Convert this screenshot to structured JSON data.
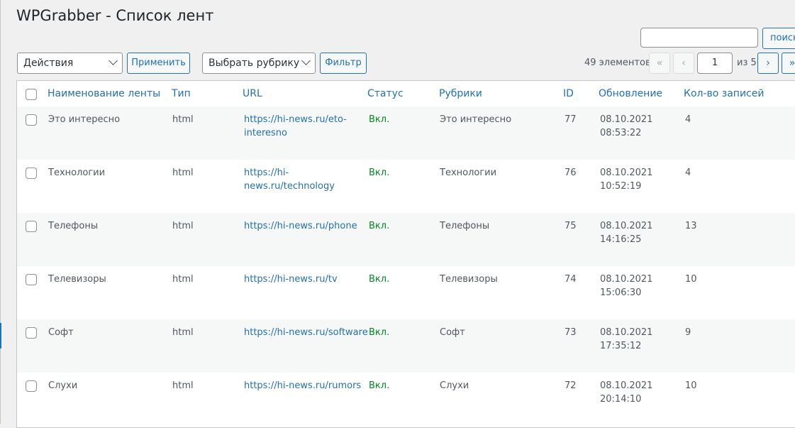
{
  "page": {
    "title": "WPGrabber - Список лент"
  },
  "search": {
    "value": "",
    "button_label": "поиск"
  },
  "toolbar": {
    "bulk_actions": "Действия",
    "apply_label": "Применить",
    "category_filter": "Выбрать рубрику",
    "filter_label": "Фильтр"
  },
  "pagination": {
    "count": "49 элементов",
    "first": "«",
    "prev": "‹",
    "current": "1",
    "of": "из 5",
    "next": "›",
    "last": "»"
  },
  "columns": [
    "Наименование ленты",
    "Тип",
    "URL",
    "Статус",
    "Рубрики",
    "ID",
    "Обновление",
    "Кол-во записей"
  ],
  "rows": [
    {
      "name": "Это интересно",
      "type": "html",
      "url1": "https://hi-news.ru/eto-",
      "url2": "interesno",
      "status": "Вкл.",
      "category": "Это интересно",
      "id": "77",
      "date": "08.10.2021",
      "time": "08:53:22",
      "count": "4"
    },
    {
      "name": "Технологии",
      "type": "html",
      "url1": "https://hi-",
      "url2": "news.ru/technology",
      "status": "Вкл.",
      "category": "Технологии",
      "id": "76",
      "date": "08.10.2021",
      "time": "10:52:19",
      "count": "4"
    },
    {
      "name": "Телефоны",
      "type": "html",
      "url1": "https://hi-news.ru/phone",
      "url2": "",
      "status": "Вкл.",
      "category": "Телефоны",
      "id": "75",
      "date": "08.10.2021",
      "time": "14:16:25",
      "count": "13"
    },
    {
      "name": "Телевизоры",
      "type": "html",
      "url1": "https://hi-news.ru/tv",
      "url2": "",
      "status": "Вкл.",
      "category": "Телевизоры",
      "id": "74",
      "date": "08.10.2021",
      "time": "15:06:30",
      "count": "10"
    },
    {
      "name": "Софт",
      "type": "html",
      "url1": "https://hi-news.ru/software",
      "url2": "",
      "status": "Вкл.",
      "category": "Софт",
      "id": "73",
      "date": "08.10.2021",
      "time": "17:35:12",
      "count": "9"
    },
    {
      "name": "Слухи",
      "type": "html",
      "url1": "https://hi-news.ru/rumors",
      "url2": "",
      "status": "Вкл.",
      "category": "Слухи",
      "id": "72",
      "date": "08.10.2021",
      "time": "20:14:10",
      "count": "10"
    }
  ],
  "colors": {
    "accent": "#2271b1",
    "status_on": "#008a20",
    "background": "#f0f0f1",
    "row_alt": "#f6f7f7"
  }
}
